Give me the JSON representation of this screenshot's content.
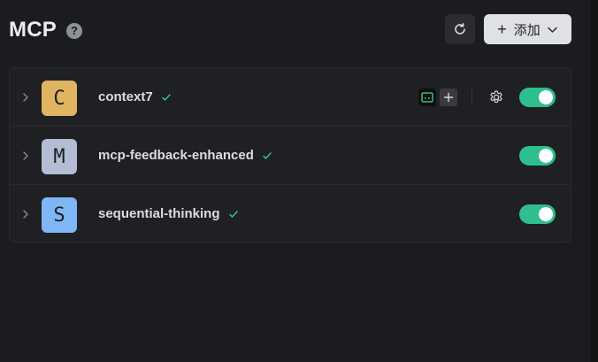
{
  "header": {
    "title": "MCP",
    "help_glyph": "?",
    "add_label": "添加",
    "add_plus": "+"
  },
  "colors": {
    "background": "#1b1c1f",
    "accent_toggle": "#2fbf8e",
    "check": "#35c08f"
  },
  "servers": [
    {
      "letter": "C",
      "name": "context7",
      "avatar_color": "#e0b460",
      "enabled": true,
      "status": "ok"
    },
    {
      "letter": "M",
      "name": "mcp-feedback-enhanced",
      "avatar_color": "#b3bdd3",
      "enabled": true,
      "status": "ok"
    },
    {
      "letter": "S",
      "name": "sequential-thinking",
      "avatar_color": "#7fb6f5",
      "enabled": true,
      "status": "ok"
    }
  ],
  "icons": {
    "help": "help-circle-icon",
    "refresh": "refresh-icon",
    "add": "plus-icon",
    "dropdown": "chevron-down-icon",
    "expand": "chevron-right-icon",
    "status": "check-icon",
    "tool_terminal": "terminal-icon",
    "tool_add": "plus-icon",
    "settings": "gear-icon"
  }
}
